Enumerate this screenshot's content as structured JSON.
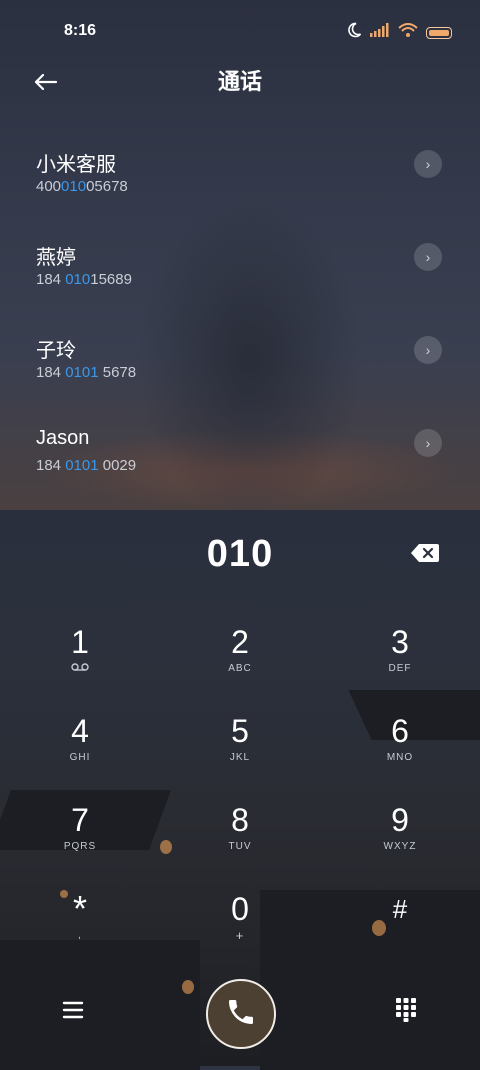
{
  "status_bar": {
    "time": "8:16"
  },
  "header": {
    "title": "通话"
  },
  "contacts": [
    {
      "name": "小米客服",
      "number_prefix": "400",
      "number_match": "010",
      "number_suffix": "05678"
    },
    {
      "name": "燕婷",
      "number_prefix": "184 ",
      "number_match": "010",
      "number_suffix": "15689"
    },
    {
      "name": "子玲",
      "number_prefix": "184 ",
      "number_match": "0101",
      "number_suffix": " 5678"
    },
    {
      "name": "Jason",
      "number_prefix": "184 ",
      "number_match": "0101",
      "number_suffix": " 0029"
    }
  ],
  "dialer": {
    "input": "010"
  },
  "keypad": [
    {
      "digit": "1",
      "letters": ""
    },
    {
      "digit": "2",
      "letters": "ABC"
    },
    {
      "digit": "3",
      "letters": "DEF"
    },
    {
      "digit": "4",
      "letters": "GHI"
    },
    {
      "digit": "5",
      "letters": "JKL"
    },
    {
      "digit": "6",
      "letters": "MNO"
    },
    {
      "digit": "7",
      "letters": "PQRS"
    },
    {
      "digit": "8",
      "letters": "TUV"
    },
    {
      "digit": "9",
      "letters": "WXYZ"
    },
    {
      "digit": "*",
      "letters": ","
    },
    {
      "digit": "0",
      "letters": "+"
    },
    {
      "digit": "#",
      "letters": ""
    }
  ],
  "colors": {
    "highlight": "#3a98ea",
    "call_button_bg": "#4b4032",
    "battery": "#f0a86a"
  },
  "icons": [
    "moon-icon",
    "signal-icon",
    "wifi-icon",
    "battery-icon",
    "back-arrow-icon",
    "chevron-right-icon",
    "backspace-icon",
    "voicemail-icon",
    "menu-icon",
    "phone-icon",
    "dialpad-icon"
  ]
}
